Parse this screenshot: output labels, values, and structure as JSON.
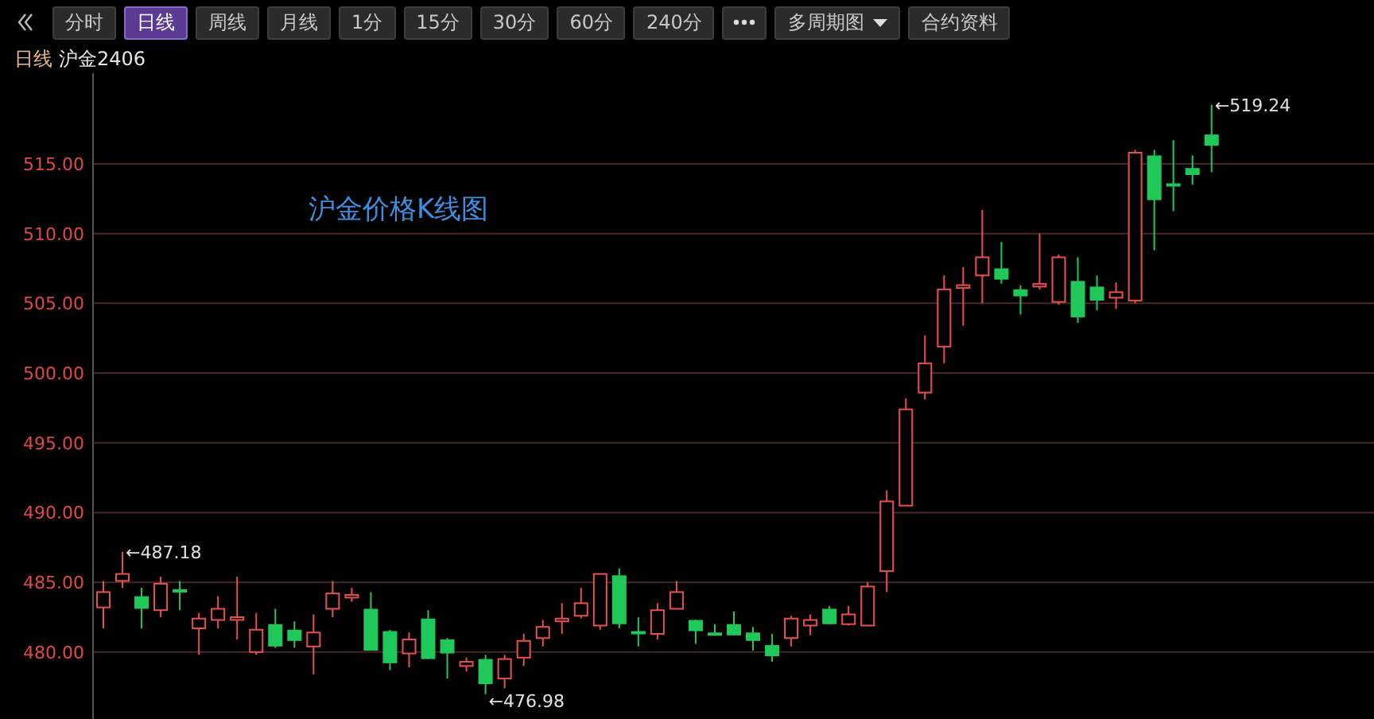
{
  "toolbar": {
    "buttons": [
      {
        "kind": "text",
        "label": "分时",
        "selected": false
      },
      {
        "kind": "text",
        "label": "日线",
        "selected": true
      },
      {
        "kind": "text",
        "label": "周线",
        "selected": false
      },
      {
        "kind": "text",
        "label": "月线",
        "selected": false
      },
      {
        "kind": "text",
        "label": "1分",
        "selected": false
      },
      {
        "kind": "text",
        "label": "15分",
        "selected": false
      },
      {
        "kind": "text",
        "label": "30分",
        "selected": false
      },
      {
        "kind": "text",
        "label": "60分",
        "selected": false
      },
      {
        "kind": "text",
        "label": "240分",
        "selected": false
      },
      {
        "kind": "more",
        "selected": false
      },
      {
        "kind": "dropdown",
        "label": "多周期图",
        "selected": false
      },
      {
        "kind": "text",
        "label": "合约资料",
        "selected": false
      }
    ]
  },
  "info": {
    "period": "日线",
    "contract": "沪金2406"
  },
  "chart": {
    "title": "沪金价格K线图",
    "chart_data": {
      "type": "candlestick",
      "ylim": [
        475.2,
        521.5
      ],
      "grid": true,
      "yticks": [
        {
          "value": 515,
          "label": "515.00"
        },
        {
          "value": 510,
          "label": "510.00"
        },
        {
          "value": 505,
          "label": "505.00"
        },
        {
          "value": 500,
          "label": "500.00"
        },
        {
          "value": 495,
          "label": "495.00"
        },
        {
          "value": 490,
          "label": "490.00"
        },
        {
          "value": 485,
          "label": "485.00"
        },
        {
          "value": 480,
          "label": "480.00"
        }
      ],
      "categories": [
        null,
        null,
        null,
        null,
        null,
        null,
        null,
        null,
        null,
        null,
        null,
        null,
        null,
        null,
        null,
        null,
        null,
        null,
        null,
        null,
        null,
        null,
        null,
        null,
        null,
        null,
        null,
        null,
        null,
        null,
        null,
        null,
        null,
        null,
        null,
        null,
        null,
        null,
        null,
        null,
        null,
        null,
        null,
        null,
        null,
        null,
        null,
        null,
        null,
        null,
        null,
        null,
        null,
        null,
        null,
        null,
        null,
        null,
        null,
        null,
        null,
        null,
        null,
        null,
        null,
        null,
        null
      ],
      "ohlc": [
        [
          483.2,
          485.1,
          481.7,
          484.3
        ],
        [
          485.1,
          487.18,
          484.6,
          485.6
        ],
        [
          484.0,
          484.6,
          481.7,
          483.1
        ],
        [
          483.0,
          485.4,
          482.5,
          484.9
        ],
        [
          484.5,
          485.1,
          483.0,
          484.3
        ],
        [
          481.7,
          482.8,
          479.8,
          482.4
        ],
        [
          482.3,
          484.0,
          481.7,
          483.1
        ],
        [
          482.3,
          485.4,
          480.9,
          482.5
        ],
        [
          480.0,
          482.8,
          479.8,
          481.6
        ],
        [
          482.0,
          483.1,
          480.3,
          480.4
        ],
        [
          481.6,
          482.2,
          480.3,
          480.8
        ],
        [
          480.4,
          482.7,
          478.4,
          481.4
        ],
        [
          483.1,
          485.1,
          482.5,
          484.2
        ],
        [
          483.9,
          484.6,
          483.6,
          484.1
        ],
        [
          483.1,
          484.3,
          480.1,
          480.1
        ],
        [
          481.5,
          481.6,
          478.7,
          479.2
        ],
        [
          479.9,
          481.4,
          478.9,
          480.9
        ],
        [
          482.4,
          483.0,
          479.5,
          479.5
        ],
        [
          480.9,
          481.0,
          478.1,
          479.9
        ],
        [
          479.0,
          479.6,
          478.6,
          479.3
        ],
        [
          479.5,
          479.8,
          476.98,
          477.7
        ],
        [
          478.1,
          479.8,
          477.4,
          479.5
        ],
        [
          479.6,
          481.3,
          479.0,
          480.8
        ],
        [
          481.0,
          482.3,
          480.4,
          481.8
        ],
        [
          482.2,
          483.5,
          481.3,
          482.4
        ],
        [
          482.6,
          484.6,
          482.4,
          483.5
        ],
        [
          481.9,
          485.6,
          481.6,
          485.6
        ],
        [
          485.5,
          486.0,
          481.7,
          482.0
        ],
        [
          481.5,
          482.5,
          480.4,
          481.3
        ],
        [
          481.3,
          483.5,
          480.9,
          483.0
        ],
        [
          483.1,
          485.1,
          483.1,
          484.3
        ],
        [
          482.3,
          482.3,
          480.6,
          481.5
        ],
        [
          481.4,
          482.0,
          481.3,
          481.3
        ],
        [
          482.0,
          482.9,
          481.2,
          481.2
        ],
        [
          481.4,
          481.8,
          480.1,
          480.8
        ],
        [
          480.5,
          481.3,
          479.3,
          479.7
        ],
        [
          481.0,
          482.6,
          480.4,
          482.4
        ],
        [
          481.9,
          482.7,
          481.2,
          482.3
        ],
        [
          483.1,
          483.3,
          482.0,
          482.0
        ],
        [
          482.0,
          483.3,
          481.9,
          482.7
        ],
        [
          481.9,
          485.0,
          481.9,
          484.7
        ],
        [
          485.8,
          491.6,
          484.3,
          490.8
        ],
        [
          490.5,
          498.2,
          490.5,
          497.4
        ],
        [
          498.6,
          502.7,
          498.1,
          500.7
        ],
        [
          501.9,
          507.0,
          500.7,
          506.0
        ],
        [
          506.1,
          507.6,
          503.4,
          506.3
        ],
        [
          507.0,
          511.7,
          505.0,
          508.3
        ],
        [
          507.5,
          509.4,
          506.4,
          506.7
        ],
        [
          506.0,
          506.3,
          504.2,
          505.5
        ],
        [
          506.2,
          510.0,
          506.0,
          506.4
        ],
        [
          505.1,
          508.5,
          504.9,
          508.3
        ],
        [
          506.6,
          508.3,
          503.6,
          504.0
        ],
        [
          506.2,
          507.0,
          504.5,
          505.2
        ],
        [
          505.4,
          506.5,
          504.6,
          505.8
        ],
        [
          505.2,
          516.0,
          505.0,
          515.8
        ],
        [
          515.6,
          516.0,
          508.8,
          512.4
        ],
        [
          513.6,
          516.7,
          511.6,
          513.4
        ],
        [
          514.7,
          515.6,
          513.5,
          514.2
        ],
        [
          517.1,
          519.24,
          514.4,
          516.3
        ],
        null,
        null,
        null,
        null,
        null,
        null,
        null,
        null
      ],
      "annotations": [
        "←487.18",
        "←476.98",
        "←519.24"
      ]
    }
  }
}
